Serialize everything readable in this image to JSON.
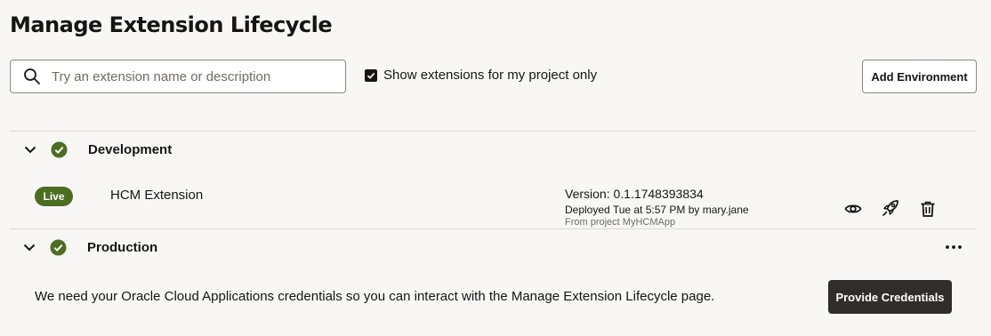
{
  "page": {
    "title": "Manage Extension Lifecycle"
  },
  "search": {
    "placeholder": "Try an extension name or description",
    "value": ""
  },
  "filter": {
    "label": "Show extensions for my project only",
    "checked": true
  },
  "toolbar": {
    "add_environment_label": "Add Environment"
  },
  "environments": [
    {
      "name": "Development",
      "status": "ok",
      "extensions": [
        {
          "badge": "Live",
          "name": "HCM Extension",
          "version": "Version: 0.1.1748393834",
          "deployed": "Deployed Tue at 5:57 PM by mary.jane",
          "from_project": "From project MyHCMApp",
          "actions": [
            "eye-icon",
            "rocket-icon",
            "trash-icon"
          ]
        }
      ]
    },
    {
      "name": "Production",
      "status": "ok",
      "message": "We need your Oracle Cloud Applications credentials so you can interact with the Manage Extension Lifecycle page.",
      "action_label": "Provide Credentials",
      "menu_icon": "more-icon"
    }
  ],
  "colors": {
    "success": "#4c6d22",
    "primary_button": "#312d2a",
    "background": "#f8f7f6"
  }
}
